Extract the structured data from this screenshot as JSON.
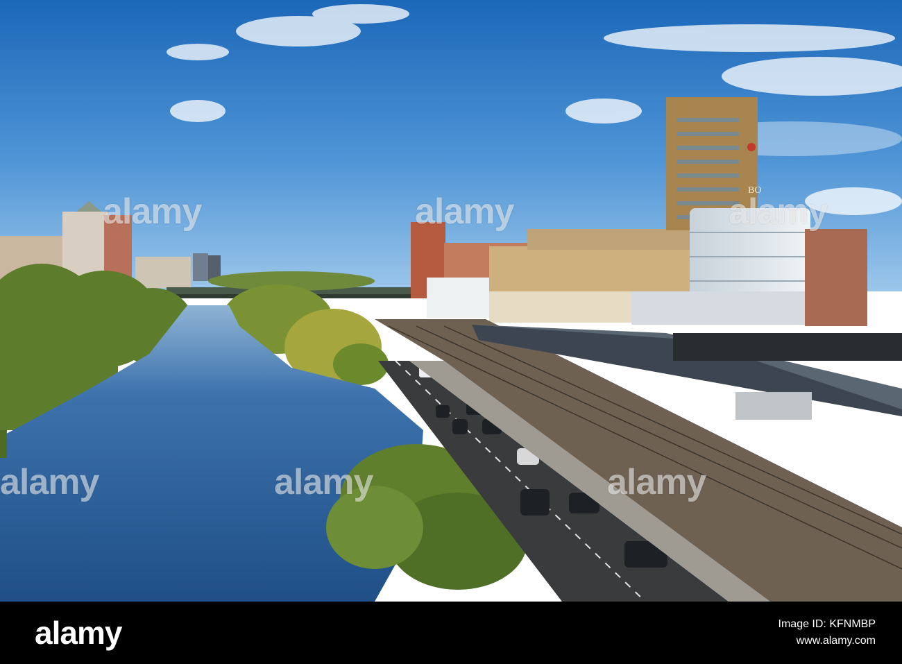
{
  "watermark": {
    "text": "alamy"
  },
  "footer": {
    "logo_text": "alamy",
    "image_id_label": "Image ID: KFNMBP",
    "site_url": "www.alamy.com"
  },
  "building_sign": {
    "text": "BO"
  },
  "colors": {
    "sky_top": "#1e6fbf",
    "sky_bottom": "#8fbfe6",
    "river": "#2b5f9a",
    "foliage": "#5c7e2a",
    "tower": "#a8844f",
    "road": "#3a3b3d",
    "footer_bg": "#000000"
  }
}
